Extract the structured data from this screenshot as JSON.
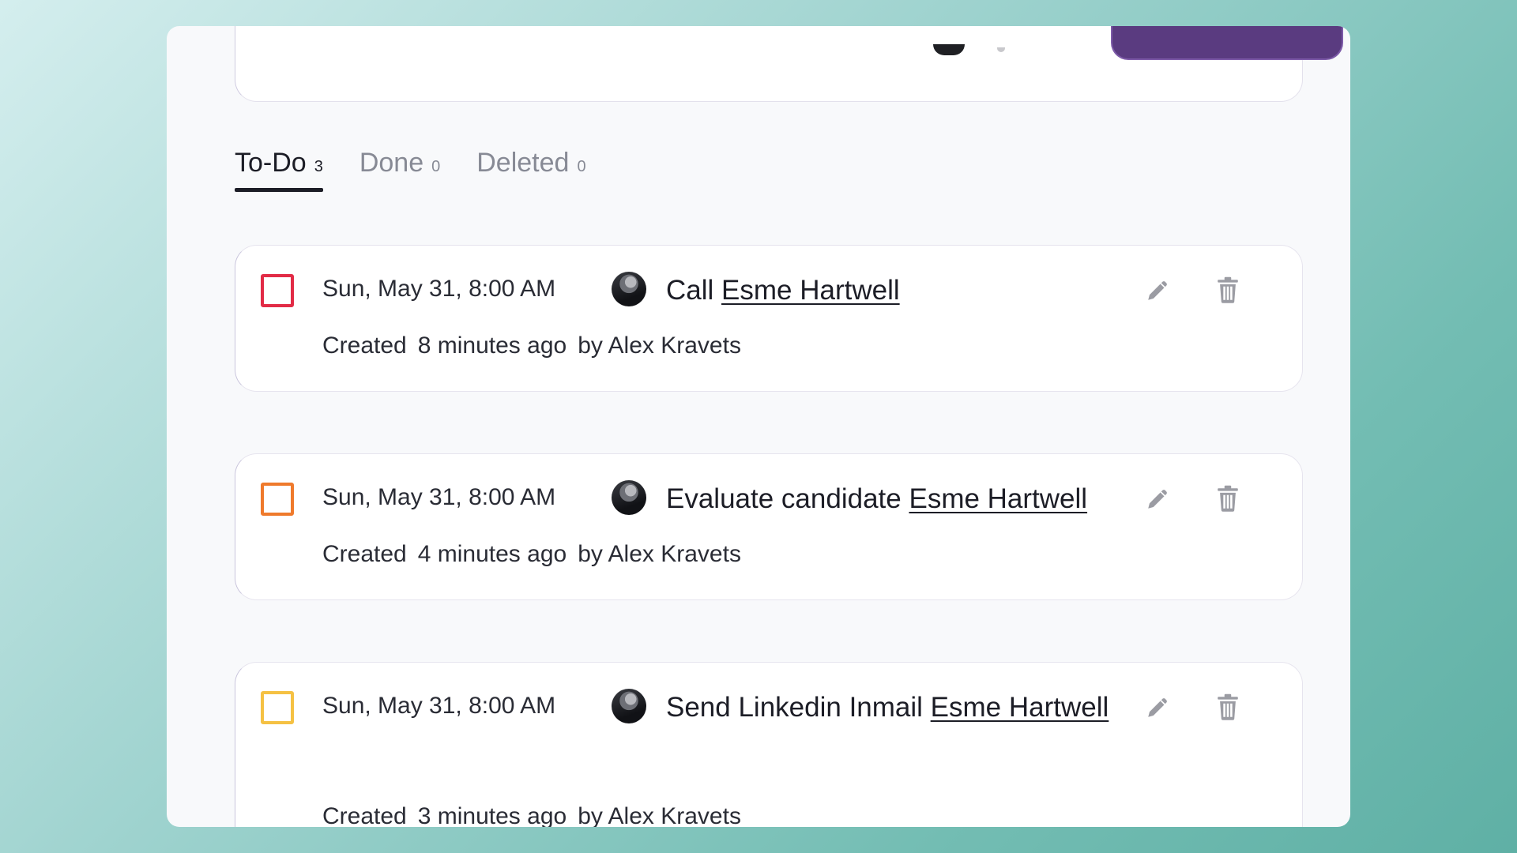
{
  "tabs": [
    {
      "label": "To-Do",
      "count": "3",
      "active": true
    },
    {
      "label": "Done",
      "count": "0",
      "active": false
    },
    {
      "label": "Deleted",
      "count": "0",
      "active": false
    }
  ],
  "tasks": [
    {
      "due": "Sun, May 31, 8:00 AM",
      "action": "Call",
      "candidate": "Esme Hartwell",
      "created_label": "Created",
      "created_ago": "8 minutes ago",
      "created_by": "by Alex Kravets",
      "priority_color": "#e22b46"
    },
    {
      "due": "Sun, May 31, 8:00 AM",
      "action": "Evaluate candidate",
      "candidate": "Esme Hartwell",
      "created_label": "Created",
      "created_ago": "4 minutes ago",
      "created_by": "by Alex Kravets",
      "priority_color": "#ef7a2c"
    },
    {
      "due": "Sun, May 31, 8:00 AM",
      "action": "Send Linkedin Inmail",
      "candidate": "Esme Hartwell",
      "created_label": "Created",
      "created_ago": "3 minutes ago",
      "created_by": "by Alex Kravets",
      "priority_color": "#f5c143"
    }
  ],
  "icons": {
    "edit": "pencil-icon",
    "delete": "trash-icon"
  },
  "colors": {
    "accent_dark": "#1c1d26",
    "muted": "#878a95",
    "icon_gray": "#9b9ca3",
    "top_button": "#5a3b80"
  }
}
